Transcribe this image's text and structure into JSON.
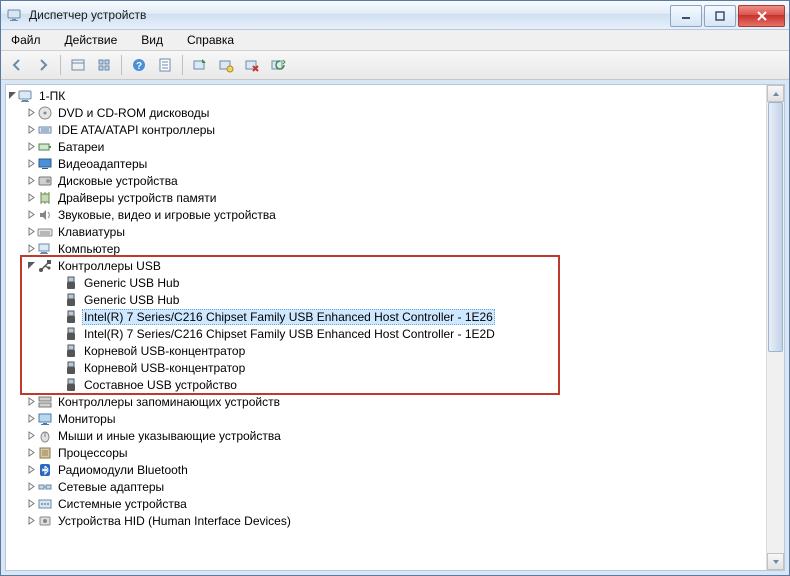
{
  "window": {
    "title": "Диспетчер устройств"
  },
  "menu": {
    "file": "Файл",
    "action": "Действие",
    "view": "Вид",
    "help": "Справка"
  },
  "tree": {
    "root": {
      "label": "1-ПК"
    },
    "categories": [
      {
        "label": "DVD и CD-ROM дисководы",
        "icon": "disc",
        "expanded": false
      },
      {
        "label": "IDE ATA/ATAPI контроллеры",
        "icon": "ide",
        "expanded": false
      },
      {
        "label": "Батареи",
        "icon": "battery",
        "expanded": false
      },
      {
        "label": "Видеоадаптеры",
        "icon": "display",
        "expanded": false
      },
      {
        "label": "Дисковые устройства",
        "icon": "disk",
        "expanded": false
      },
      {
        "label": "Драйверы устройств памяти",
        "icon": "chip",
        "expanded": false
      },
      {
        "label": "Звуковые, видео и игровые устройства",
        "icon": "sound",
        "expanded": false
      },
      {
        "label": "Клавиатуры",
        "icon": "keyboard",
        "expanded": false
      },
      {
        "label": "Компьютер",
        "icon": "computer",
        "expanded": false
      },
      {
        "label": "Контроллеры USB",
        "icon": "usb",
        "expanded": true,
        "children": [
          {
            "label": "Generic USB Hub",
            "selected": false
          },
          {
            "label": "Generic USB Hub",
            "selected": false
          },
          {
            "label": "Intel(R) 7 Series/C216 Chipset Family USB Enhanced Host Controller - 1E26",
            "selected": true
          },
          {
            "label": "Intel(R) 7 Series/C216 Chipset Family USB Enhanced Host Controller - 1E2D",
            "selected": false
          },
          {
            "label": "Корневой USB-концентратор",
            "selected": false
          },
          {
            "label": "Корневой USB-концентратор",
            "selected": false
          },
          {
            "label": "Составное USB устройство",
            "selected": false
          }
        ]
      },
      {
        "label": "Контроллеры запоминающих устройств",
        "icon": "storage",
        "expanded": false
      },
      {
        "label": "Мониторы",
        "icon": "monitor",
        "expanded": false
      },
      {
        "label": "Мыши и иные указывающие устройства",
        "icon": "mouse",
        "expanded": false
      },
      {
        "label": "Процессоры",
        "icon": "cpu",
        "expanded": false
      },
      {
        "label": "Радиомодули Bluetooth",
        "icon": "bluetooth",
        "expanded": false
      },
      {
        "label": "Сетевые адаптеры",
        "icon": "network",
        "expanded": false
      },
      {
        "label": "Системные устройства",
        "icon": "system",
        "expanded": false
      },
      {
        "label": "Устройства HID (Human Interface Devices)",
        "icon": "hid",
        "expanded": false
      }
    ]
  }
}
